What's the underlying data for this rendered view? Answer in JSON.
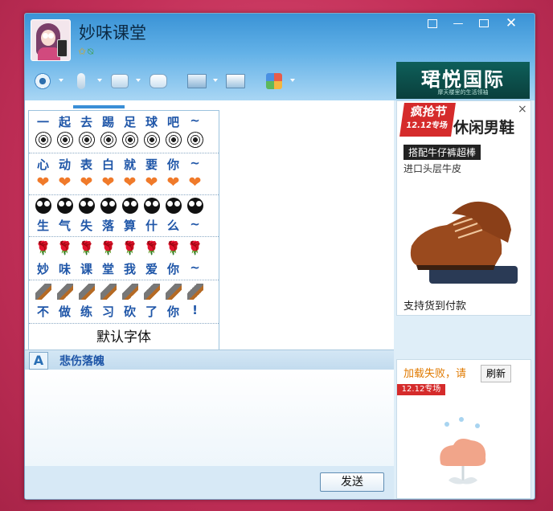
{
  "window": {
    "contact_name": "妙味课堂",
    "icons": [
      "star-icon",
      "qzone-icon"
    ]
  },
  "title_controls": [
    "skin-button",
    "minimize-button",
    "maximize-button",
    "close-button"
  ],
  "toolbar": {
    "items": [
      "video-call-icon",
      "voice-call-icon",
      "file-transfer-icon",
      "message-icon",
      "remote-assist-icon",
      "screen-share-icon",
      "apps-icon"
    ]
  },
  "banner": {
    "title": "珺悦国际",
    "subtitle": "摩天楼里的生活领袖"
  },
  "picker": {
    "rows": [
      {
        "text": [
          "一",
          "起",
          "去",
          "踢",
          "足",
          "球",
          "吧",
          "~"
        ],
        "emoji": "ball"
      },
      {
        "text": [
          "心",
          "动",
          "表",
          "白",
          "就",
          "要",
          "你",
          "~"
        ],
        "emoji": "heart"
      },
      {
        "text": [
          "生",
          "气",
          "失",
          "落",
          "算",
          "什",
          "么",
          "~"
        ],
        "emoji": "face"
      },
      {
        "text": [
          "妙",
          "味",
          "课",
          "堂",
          "我",
          "爱",
          "你",
          "~"
        ],
        "emoji": "rose"
      },
      {
        "text": [
          "不",
          "做",
          "练",
          "习",
          "砍",
          "了",
          "你",
          "!"
        ],
        "emoji": "knife"
      }
    ],
    "default_font": "默认字体"
  },
  "font_bar": {
    "font_name": "悲伤落魄"
  },
  "send_button": "发送",
  "ad1": {
    "tag_main": "疯抢节",
    "tag_sub": "12.12专场",
    "headline": "休闲男鞋",
    "sub1": "搭配牛仔裤超棒",
    "sub2": "进口头层牛皮",
    "pay": "支持货到付款",
    "close": "×"
  },
  "ad2": {
    "error": "加载失败，请",
    "refresh": "刷新",
    "tag": "12.12专场"
  },
  "colors": {
    "accent": "#3a93d6",
    "text_blue": "#1f56a8",
    "promo_red": "#d52b2b"
  }
}
